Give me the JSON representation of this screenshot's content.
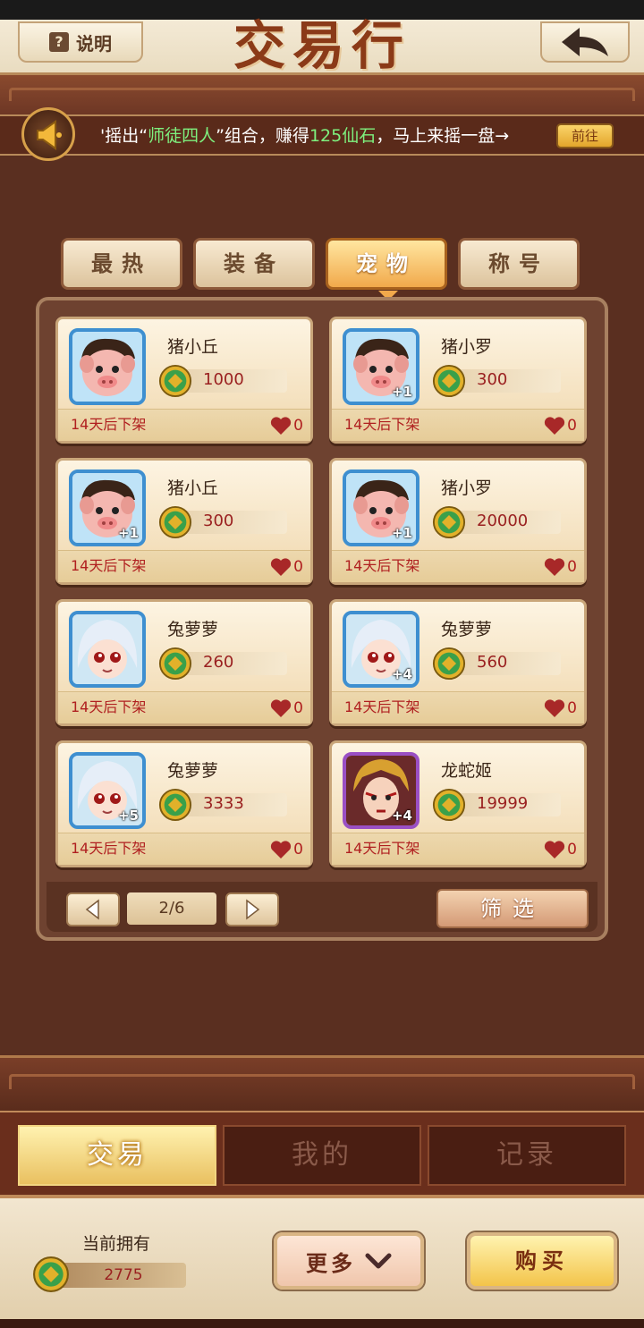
{
  "header": {
    "help_label": "说明",
    "title": "交易行"
  },
  "marquee": {
    "prefix": "'摇出“",
    "highlight_combo": "师徒四人",
    "middle": "”组合，赚得",
    "highlight_reward": "125仙石",
    "suffix": "，马上来摇一盘→",
    "goto_label": "前往"
  },
  "category_tabs": [
    {
      "label": "最热",
      "active": false
    },
    {
      "label": "装备",
      "active": false
    },
    {
      "label": "宠物",
      "active": true
    },
    {
      "label": "称号",
      "active": false
    }
  ],
  "listings": [
    {
      "name": "猪小丘",
      "price": "1000",
      "plus": "",
      "expire": "14天后下架",
      "likes": "0",
      "avatar": "pig"
    },
    {
      "name": "猪小罗",
      "price": "300",
      "plus": "+1",
      "expire": "14天后下架",
      "likes": "0",
      "avatar": "pig"
    },
    {
      "name": "猪小丘",
      "price": "300",
      "plus": "+1",
      "expire": "14天后下架",
      "likes": "0",
      "avatar": "pig"
    },
    {
      "name": "猪小罗",
      "price": "20000",
      "plus": "+1",
      "expire": "14天后下架",
      "likes": "0",
      "avatar": "pig"
    },
    {
      "name": "兔萝萝",
      "price": "260",
      "plus": "",
      "expire": "14天后下架",
      "likes": "0",
      "avatar": "rabbit"
    },
    {
      "name": "兔萝萝",
      "price": "560",
      "plus": "+4",
      "expire": "14天后下架",
      "likes": "0",
      "avatar": "rabbit"
    },
    {
      "name": "兔萝萝",
      "price": "3333",
      "plus": "+5",
      "expire": "14天后下架",
      "likes": "0",
      "avatar": "rabbit"
    },
    {
      "name": "龙蛇姬",
      "price": "19999",
      "plus": "+4",
      "expire": "14天后下架",
      "likes": "0",
      "avatar": "dragon"
    }
  ],
  "pager": {
    "page_indicator": "2/6",
    "filter_label": "筛选"
  },
  "main_tabs": [
    {
      "label": "交易",
      "active": true
    },
    {
      "label": "我的",
      "active": false
    },
    {
      "label": "记录",
      "active": false
    }
  ],
  "footer": {
    "holding_label": "当前拥有",
    "holding_amount": "2775",
    "more_label": "更多",
    "buy_label": "购买"
  },
  "colors": {
    "accent_gold": "#f1a94b",
    "price_red": "#9a2020",
    "background_brown": "#5a2f20"
  }
}
